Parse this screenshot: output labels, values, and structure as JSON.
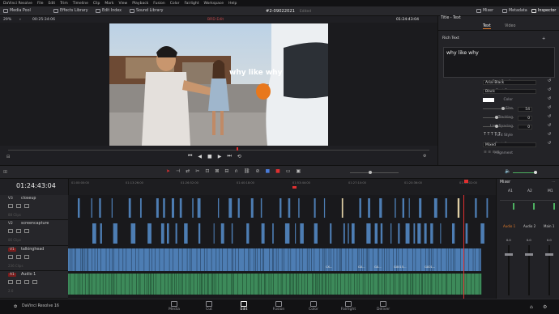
{
  "menu": {
    "items": [
      "DaVinci Resolve",
      "File",
      "Edit",
      "Trim",
      "Timeline",
      "Clip",
      "Mark",
      "View",
      "Playback",
      "Fusion",
      "Color",
      "Fairlight",
      "Workspace",
      "Help"
    ]
  },
  "toolbar": {
    "media_pool": "Media Pool",
    "effects_library": "Effects Library",
    "edit_index": "Edit Index",
    "sound_library": "Sound Library",
    "project_title": "#2-09022021",
    "project_status": "Edited",
    "mixer": "Mixer",
    "metadata": "Metadata",
    "inspector": "Inspector"
  },
  "viewer": {
    "zoom": "29%",
    "source_tc": "00:25:34:06",
    "clip_name": "BRD Edit",
    "record_tc": "01:24:43:04",
    "overlay_text": "why like why"
  },
  "inspector": {
    "header": "Title - Text",
    "tabs": [
      "Text",
      "Video"
    ],
    "active_tab": "Text",
    "section": "Rich Text",
    "rich_text": "why like why",
    "font_family_label": "Font Family",
    "font_family": "Arial Black",
    "font_face_label": "Font Face",
    "font_face": "Black",
    "color_label": "Color",
    "size_label": "Size",
    "size": "54",
    "tracking_label": "Tracking",
    "tracking": "0",
    "line_spacing_label": "Line Spacing",
    "line_spacing": "0",
    "font_style_label": "Font Style",
    "font_style_glyphs": "T  T  T  T  T",
    "font_case_label": "Font Case",
    "font_case": "Mixed",
    "alignment_label": "Alignment",
    "colors": {
      "text": "#ffffff",
      "accent": "#e07b2a"
    }
  },
  "timeline": {
    "timecode": "01:24:43:04",
    "ruler": [
      "01:00:00:00",
      "01:13:26:00",
      "01:26:52:00",
      "01:40:18:00",
      "01:53:44:00",
      "01:27:10:00",
      "01:20:36:00",
      "01:34:02:00"
    ],
    "tracks": [
      {
        "id": "V3",
        "name": "closeup",
        "sub": "88 Clips"
      },
      {
        "id": "V2",
        "name": "screencapture",
        "sub": "86 Clips"
      },
      {
        "id": "V1",
        "name": "talkinghead",
        "sub": "236 Clips"
      },
      {
        "id": "A1",
        "name": "Audio 1",
        "sub": "2.0"
      }
    ],
    "clip_labels": [
      "CX...",
      "GX...",
      "GX...",
      "GX015...",
      "GX01..."
    ],
    "colors": {
      "video": "#4d7db3",
      "audio": "#3d8a5a",
      "playhead": "#e03030",
      "closeup_clip": "#e0cfa5"
    }
  },
  "mixer": {
    "title": "Mixer",
    "channels": [
      "A1",
      "A2",
      "M1"
    ],
    "bus_labels": [
      "Audio 1",
      "Audio 2",
      "Main 1"
    ],
    "values": [
      "0.0",
      "0.0",
      "0.0"
    ]
  },
  "pages": {
    "app_name": "DaVinci Resolve 16",
    "items": [
      "Media",
      "Cut",
      "Edit",
      "Fusion",
      "Color",
      "Fairlight",
      "Deliver"
    ],
    "active": "Edit"
  }
}
